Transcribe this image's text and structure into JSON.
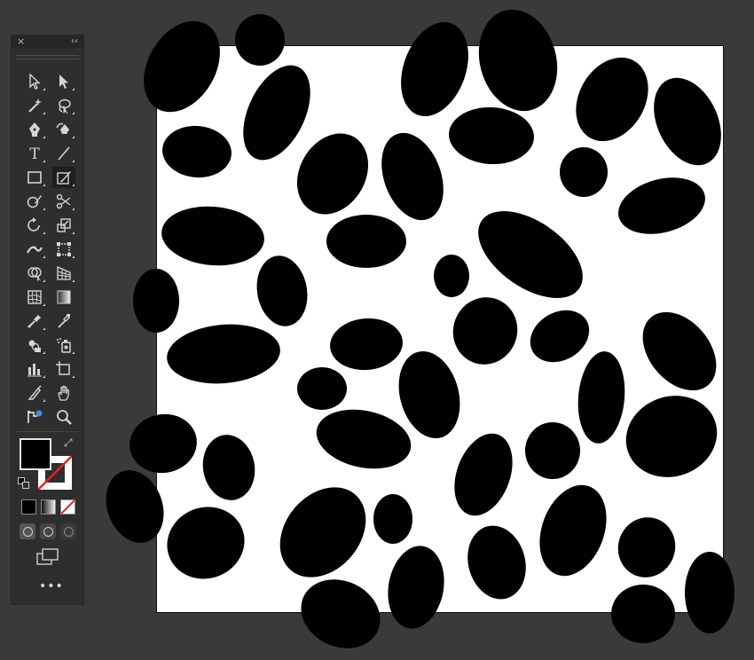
{
  "toolbar": {
    "close_glyph": "×",
    "collapse_glyph": "‹‹",
    "more_label": "•••",
    "swap_glyph": "⤢",
    "tools": [
      {
        "name": "selection-tool",
        "icon": "arrow-outline-icon"
      },
      {
        "name": "direct-selection-tool",
        "icon": "arrow-filled-icon"
      },
      {
        "name": "magic-wand-tool",
        "icon": "magic-wand-icon"
      },
      {
        "name": "lasso-tool",
        "icon": "lasso-icon"
      },
      {
        "name": "pen-tool",
        "icon": "pen-icon"
      },
      {
        "name": "curvature-tool",
        "icon": "curvature-icon"
      },
      {
        "name": "type-tool",
        "icon": "type-icon",
        "label": "T"
      },
      {
        "name": "line-segment-tool",
        "icon": "line-icon"
      },
      {
        "name": "rectangle-tool",
        "icon": "rectangle-icon"
      },
      {
        "name": "paintbrush-tool",
        "icon": "paintbrush-icon",
        "active": true
      },
      {
        "name": "shaper-tool",
        "icon": "shaper-icon"
      },
      {
        "name": "scissors-tool",
        "icon": "scissors-icon"
      },
      {
        "name": "rotate-tool",
        "icon": "rotate-icon"
      },
      {
        "name": "scale-tool",
        "icon": "scale-icon"
      },
      {
        "name": "width-tool",
        "icon": "width-icon"
      },
      {
        "name": "free-transform-tool",
        "icon": "free-transform-icon"
      },
      {
        "name": "shape-builder-tool",
        "icon": "shape-builder-icon"
      },
      {
        "name": "perspective-grid-tool",
        "icon": "perspective-grid-icon"
      },
      {
        "name": "mesh-tool",
        "icon": "mesh-icon"
      },
      {
        "name": "gradient-tool",
        "icon": "gradient-icon"
      },
      {
        "name": "eyedropper-tool",
        "icon": "eyedropper-icon"
      },
      {
        "name": "blend-tool",
        "icon": "blend-icon"
      },
      {
        "name": "symbol-sprayer-tool",
        "icon": "symbol-sprayer-icon"
      },
      {
        "name": "column-graph-tool",
        "icon": "column-graph-icon"
      },
      {
        "name": "artboard-tool",
        "icon": "artboard-icon"
      },
      {
        "name": "slice-tool",
        "icon": "slice-icon"
      },
      {
        "name": "hand-tool",
        "icon": "hand-icon"
      },
      {
        "name": "puppet-warp-tool",
        "icon": "puppet-warp-icon"
      },
      {
        "name": "zoom-tool",
        "icon": "zoom-icon"
      }
    ],
    "colors": {
      "fill": "#000000",
      "stroke": "none",
      "panel_bg": "#2e2e2e",
      "icon": "#d4d4d4",
      "accent": "#3d8fe0",
      "none_slash": "#e1251b"
    }
  },
  "canvas": {
    "background": "#3a3a3a",
    "artboard_color": "#ffffff",
    "pattern": "leopard-print-spots",
    "spot_color": "#000000"
  }
}
